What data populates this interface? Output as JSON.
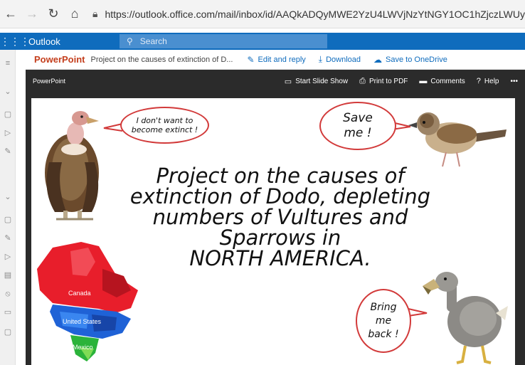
{
  "browser": {
    "url": "https://outlook.office.com/mail/inbox/id/AAQkADQyMWE2YzU4LWVjNzYtNGY1OC1hZjczLWUyM2I1NzBiODM2"
  },
  "outlook": {
    "app_name": "Outlook",
    "search_placeholder": "Search"
  },
  "viewer": {
    "app": "PowerPoint",
    "file_title": "Project on the causes of extinction of D...",
    "edit_reply": "Edit and reply",
    "download": "Download",
    "save_onedrive": "Save to OneDrive"
  },
  "toolbar": {
    "brand": "PowerPoint",
    "start_slide_show": "Start Slide Show",
    "print_pdf": "Print to PDF",
    "comments": "Comments",
    "help": "Help"
  },
  "slide": {
    "title_line1": "Project on the causes of",
    "title_line2": "extinction of Dodo, depleting",
    "title_line3": "numbers of Vultures and",
    "title_line4": "Sparrows in",
    "title_line5": "NORTH AMERICA.",
    "vulture_bubble_l1": "I don't want to",
    "vulture_bubble_l2": "become extinct !",
    "sparrow_bubble_l1": "Save",
    "sparrow_bubble_l2": "me !",
    "dodo_bubble_l1": "Bring",
    "dodo_bubble_l2": "me",
    "dodo_bubble_l3": "back !",
    "map_label_canada": "Canada",
    "map_label_us": "United States",
    "map_label_mexico": "Mexico"
  }
}
